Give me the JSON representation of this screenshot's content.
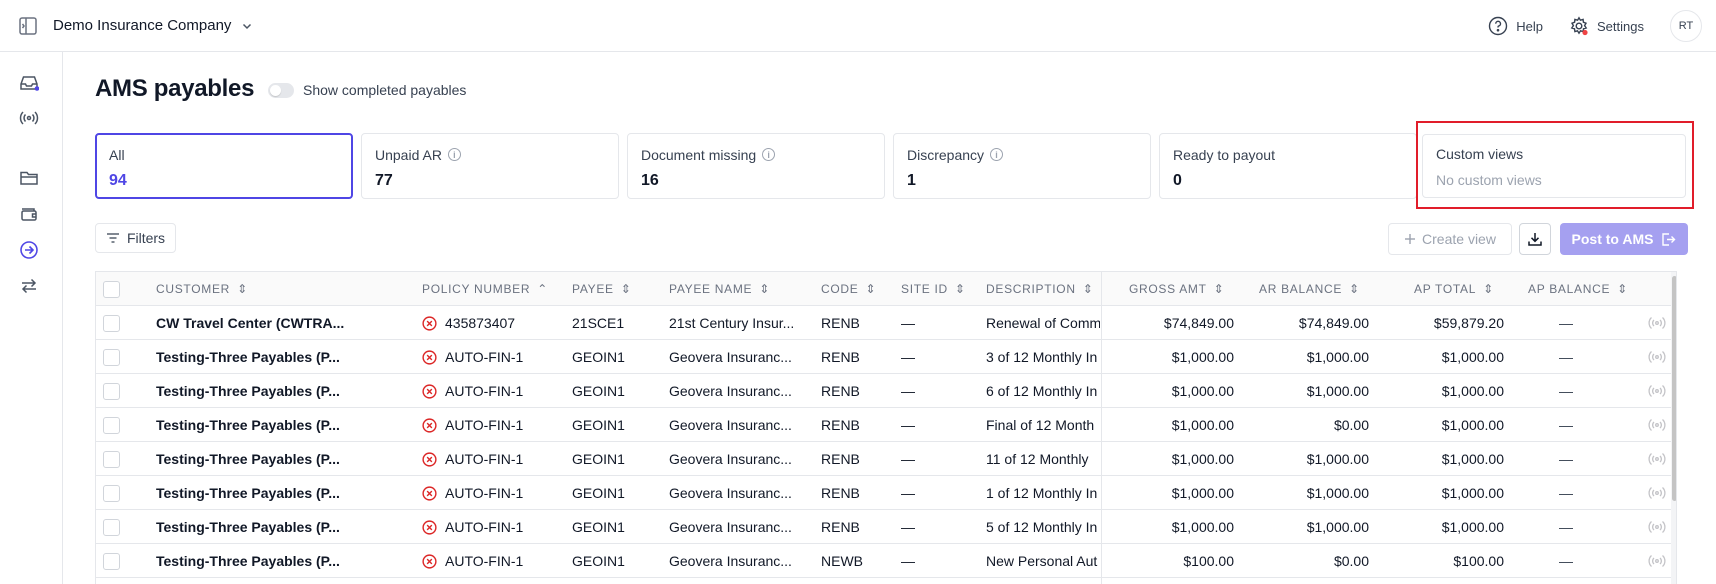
{
  "header": {
    "company_name": "Demo Insurance Company",
    "help_label": "Help",
    "settings_label": "Settings",
    "avatar_initials": "RT"
  },
  "page": {
    "title": "AMS payables",
    "toggle_label": "Show completed payables",
    "toggle_on": false
  },
  "summary_cards": [
    {
      "label": "All",
      "value": "94"
    },
    {
      "label": "Unpaid AR",
      "value": "77"
    },
    {
      "label": "Document missing",
      "value": "16"
    },
    {
      "label": "Discrepancy",
      "value": "1"
    },
    {
      "label": "Ready to payout",
      "value": "0"
    },
    {
      "label": "Custom views",
      "value": "No custom views"
    }
  ],
  "toolbar": {
    "filters_label": "Filters",
    "create_view_label": "Create view",
    "post_label": "Post to AMS"
  },
  "table": {
    "columns": [
      "Customer",
      "Policy Number",
      "Payee",
      "Payee Name",
      "Code",
      "Site ID",
      "Description",
      "Gross Amt",
      "AR Balance",
      "AP Total",
      "AP Balance"
    ],
    "rows": [
      {
        "customer": "CW Travel Center (CWTRA...",
        "policy": "435873407",
        "payee": "21SCE1",
        "payee_name": "21st Century Insur...",
        "code": "RENB",
        "site_id": "—",
        "description": "Renewal of Comm",
        "gross": "$74,849.00",
        "ar_balance": "$74,849.00",
        "ap_total": "$59,879.20",
        "ap_balance": "—"
      },
      {
        "customer": "Testing-Three Payables (P...",
        "policy": "AUTO-FIN-1",
        "payee": "GEOIN1",
        "payee_name": "Geovera Insuranc...",
        "code": "RENB",
        "site_id": "—",
        "description": "3 of 12 Monthly In",
        "gross": "$1,000.00",
        "ar_balance": "$1,000.00",
        "ap_total": "$1,000.00",
        "ap_balance": "—"
      },
      {
        "customer": "Testing-Three Payables (P...",
        "policy": "AUTO-FIN-1",
        "payee": "GEOIN1",
        "payee_name": "Geovera Insuranc...",
        "code": "RENB",
        "site_id": "—",
        "description": "6 of 12 Monthly In",
        "gross": "$1,000.00",
        "ar_balance": "$1,000.00",
        "ap_total": "$1,000.00",
        "ap_balance": "—"
      },
      {
        "customer": "Testing-Three Payables (P...",
        "policy": "AUTO-FIN-1",
        "payee": "GEOIN1",
        "payee_name": "Geovera Insuranc...",
        "code": "RENB",
        "site_id": "—",
        "description": "Final of 12 Month",
        "gross": "$1,000.00",
        "ar_balance": "$0.00",
        "ap_total": "$1,000.00",
        "ap_balance": "—"
      },
      {
        "customer": "Testing-Three Payables (P...",
        "policy": "AUTO-FIN-1",
        "payee": "GEOIN1",
        "payee_name": "Geovera Insuranc...",
        "code": "RENB",
        "site_id": "—",
        "description": "11 of 12 Monthly",
        "gross": "$1,000.00",
        "ar_balance": "$1,000.00",
        "ap_total": "$1,000.00",
        "ap_balance": "—"
      },
      {
        "customer": "Testing-Three Payables (P...",
        "policy": "AUTO-FIN-1",
        "payee": "GEOIN1",
        "payee_name": "Geovera Insuranc...",
        "code": "RENB",
        "site_id": "—",
        "description": "1 of 12 Monthly In",
        "gross": "$1,000.00",
        "ar_balance": "$1,000.00",
        "ap_total": "$1,000.00",
        "ap_balance": "—"
      },
      {
        "customer": "Testing-Three Payables (P...",
        "policy": "AUTO-FIN-1",
        "payee": "GEOIN1",
        "payee_name": "Geovera Insuranc...",
        "code": "RENB",
        "site_id": "—",
        "description": "5 of 12 Monthly In",
        "gross": "$1,000.00",
        "ar_balance": "$1,000.00",
        "ap_total": "$1,000.00",
        "ap_balance": "—"
      },
      {
        "customer": "Testing-Three Payables (P...",
        "policy": "AUTO-FIN-1",
        "payee": "GEOIN1",
        "payee_name": "Geovera Insuranc...",
        "code": "NEWB",
        "site_id": "—",
        "description": "New Personal Aut",
        "gross": "$100.00",
        "ar_balance": "$0.00",
        "ap_total": "$100.00",
        "ap_balance": "—"
      }
    ]
  },
  "colors": {
    "accent": "#4f46e5",
    "post_button": "#a5a0f0",
    "error": "#dc2626",
    "highlight": "#e11d2a"
  },
  "icons": {
    "sidebar": [
      "inbox-icon",
      "broadcast-icon",
      "folder-icon",
      "wallet-icon",
      "arrow-right-circle-icon",
      "transfer-icon"
    ],
    "row_status": "x-circle-icon",
    "row_action": "broadcast-icon"
  }
}
